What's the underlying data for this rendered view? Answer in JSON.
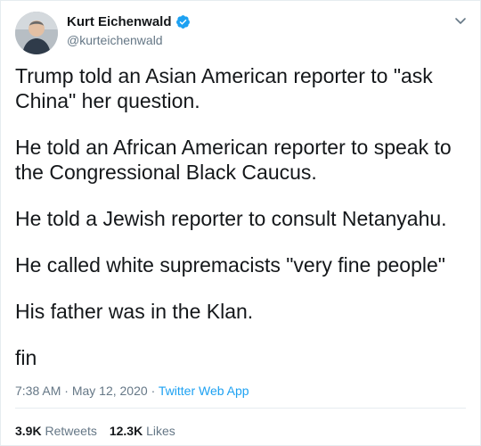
{
  "author": {
    "display_name": "Kurt Eichenwald",
    "handle": "@kurteichenwald",
    "verified": true
  },
  "tweet": {
    "paragraphs": [
      "Trump told an Asian American reporter to \"ask China\" her question.",
      "He told an African American reporter to speak to the Congressional Black Caucus.",
      "He told a Jewish reporter to consult Netanyahu.",
      "He called white supremacists \"very fine people\"",
      "His father was in the Klan.",
      "fin"
    ],
    "time": "7:38 AM",
    "separator": "·",
    "date": "May 12, 2020",
    "source": "Twitter Web App"
  },
  "stats": {
    "retweets_count": "3.9K",
    "retweets_label": "Retweets",
    "likes_count": "12.3K",
    "likes_label": "Likes"
  },
  "icons": {
    "verified": "verified-badge-icon",
    "menu": "chevron-down-icon"
  },
  "colors": {
    "accent": "#1da1f2",
    "secondary_text": "#657786",
    "border": "#e6ecf0"
  }
}
